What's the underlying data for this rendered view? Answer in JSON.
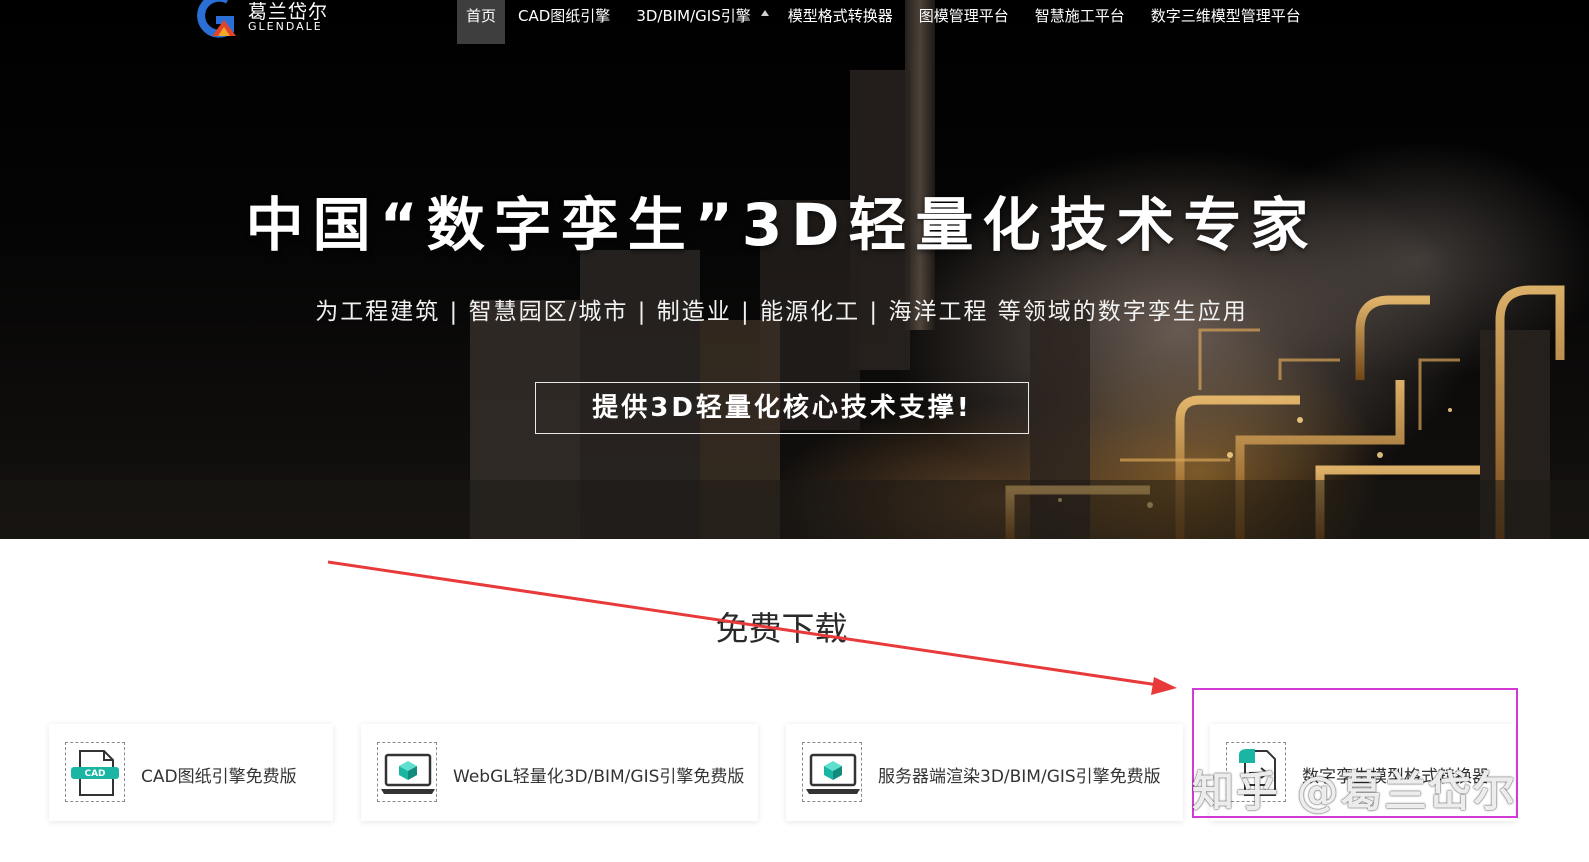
{
  "logo": {
    "cn": "葛兰岱尔",
    "en": "GLENDALE"
  },
  "nav": {
    "items": [
      "首页",
      "CAD图纸引擎",
      "3D/BIM/GIS引擎",
      "模型格式转换器",
      "图模管理平台",
      "智慧施工平台",
      "数字三维模型管理平台"
    ]
  },
  "hero": {
    "headline": "中国“数字孪生”3D轻量化技术专家",
    "subline": "为工程建筑 | 智慧园区/城市 | 制造业 | 能源化工 | 海洋工程 等领域的数字孪生应用",
    "cta": "提供3D轻量化核心技术支撑!"
  },
  "downloads": {
    "title": "免费下载",
    "cards": [
      {
        "label": "CAD图纸引擎免费版",
        "icon": "cad-file-icon",
        "icon_text": "CAD"
      },
      {
        "label": "WebGL轻量化3D/BIM/GIS引擎免费版",
        "icon": "laptop-cube-icon"
      },
      {
        "label": "服务器端渲染3D/BIM/GIS引擎免费版",
        "icon": "laptop-cube-icon"
      },
      {
        "label": "数字孪生模型格式转换器",
        "icon": "convert-file-icon"
      }
    ]
  },
  "watermark": "知乎 @葛兰岱尔",
  "colors": {
    "accent": "#1ab5a3",
    "arrow": "#e83a3a",
    "highlight": "#d23ad6"
  }
}
